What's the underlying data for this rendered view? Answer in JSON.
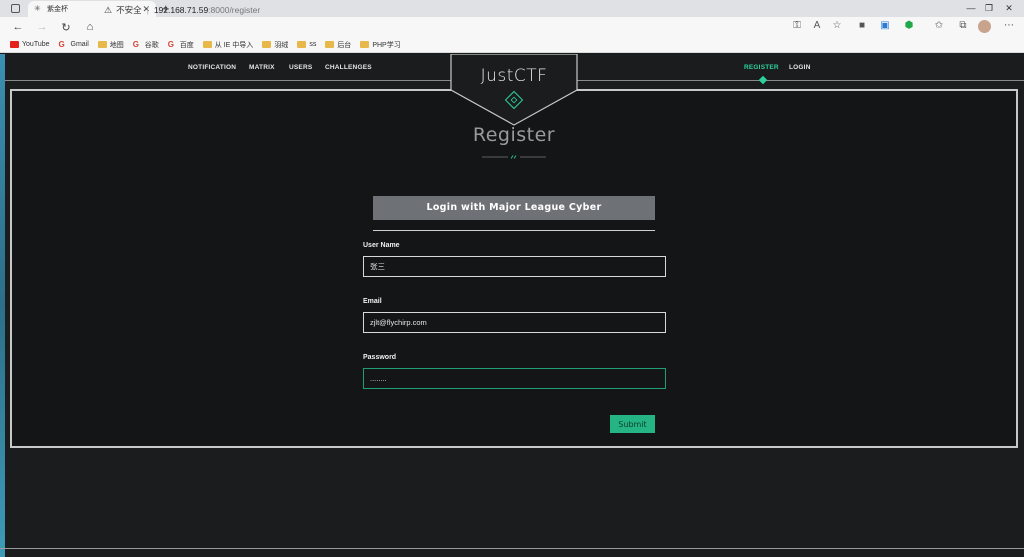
{
  "browser": {
    "tab_title": "紫金杯",
    "new_tab": "+",
    "security_label": "不安全",
    "url_host": "192.168.71.59",
    "url_path": ":8000/register",
    "window_controls": [
      "—",
      "❐",
      "✕"
    ],
    "bookmarks": [
      {
        "label": "YouTube",
        "kind": "yt"
      },
      {
        "label": "Gmail",
        "kind": "g"
      },
      {
        "label": "地图",
        "kind": "folder"
      },
      {
        "label": "谷歌",
        "kind": "g"
      },
      {
        "label": "百度",
        "kind": "g"
      },
      {
        "label": "从 IE 中导入",
        "kind": "folder"
      },
      {
        "label": "羽绒",
        "kind": "folder"
      },
      {
        "label": "ss",
        "kind": "folder"
      },
      {
        "label": "后台",
        "kind": "folder"
      },
      {
        "label": "PHP学习",
        "kind": "folder"
      }
    ]
  },
  "nav": {
    "left_links": [
      "NOTIFICATION",
      "MATRIX",
      "USERS",
      "CHALLENGES"
    ],
    "right_links": [
      "REGISTER",
      "LOGIN"
    ],
    "active": "REGISTER"
  },
  "logo": {
    "text": "JustCTF"
  },
  "page": {
    "title": "Register"
  },
  "form": {
    "mlc_button": "Login with Major League Cyber",
    "username_label": "User Name",
    "username_value": "张三",
    "email_label": "Email",
    "email_value": "zjlt@flychirp.com",
    "password_label": "Password",
    "password_value": "........",
    "submit_label": "Submit"
  },
  "colors": {
    "accent": "#2bd39a",
    "submit_bg": "#25b584",
    "background": "#1b1c1e",
    "button_gray": "#6e7277"
  }
}
